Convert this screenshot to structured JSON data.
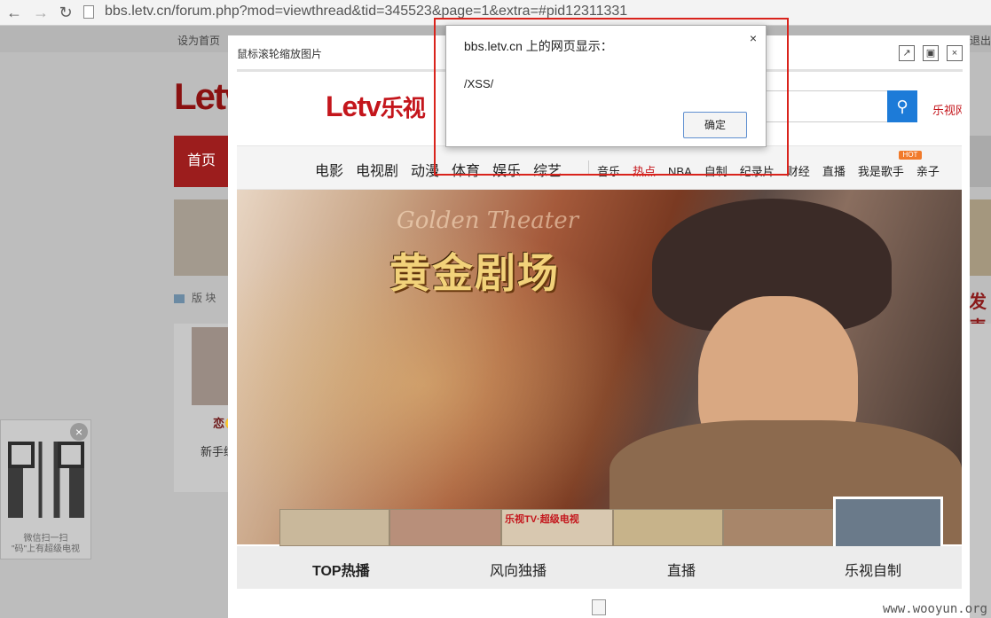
{
  "browser": {
    "url": "bbs.letv.cn/forum.php?mod=viewthread&tid=345523&page=1&extra=#pid12311331"
  },
  "bg_page": {
    "topbar_left": "设为首页",
    "topbar_right": "退出",
    "logo": "Letv",
    "nav_first": "首页",
    "breadcrumb": "版 块",
    "user_name": "恋🙂",
    "user_rank": "新手练",
    "right_banner_text": "发表"
  },
  "qr": {
    "line1": "微信扫一扫",
    "line2": "\"码\"上有超级电视"
  },
  "viewer": {
    "tip": "鼠标滚轮缩放图片",
    "logo_latin": "Letv",
    "logo_cn": "乐视",
    "right_link": "乐视网",
    "nav_main": [
      "电影",
      "电视剧",
      "动漫",
      "体育",
      "娱乐",
      "综艺"
    ],
    "nav_sub": [
      "音乐",
      "热点",
      "NBA",
      "自制",
      "纪录片",
      "财经",
      "直播",
      "我是歌手",
      "亲子"
    ],
    "hot_badge": "HOT",
    "banner_title": "黄金剧场",
    "banner_sub": "Golden Theater",
    "thumb_label": "乐视TV·超级电视",
    "tabs": [
      "TOP热播",
      "风向独播",
      "直播",
      "乐视自制"
    ]
  },
  "alert": {
    "title": "bbs.letv.cn 上的网页显示：",
    "message": "/XSS/",
    "ok": "确定",
    "close": "×"
  },
  "watermark": "www.wooyun.org"
}
